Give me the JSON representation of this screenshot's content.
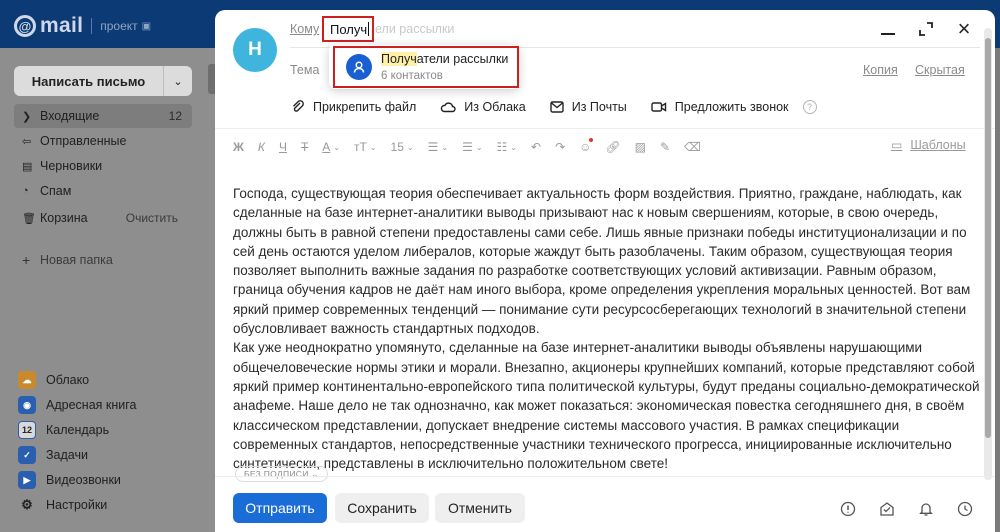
{
  "app": {
    "logo_text": "mail",
    "logo_sub": "проект"
  },
  "sidebar": {
    "compose_label": "Написать письмо",
    "folders": [
      {
        "label": "Входящие",
        "count": "12"
      },
      {
        "label": "Отправленные"
      },
      {
        "label": "Черновики"
      },
      {
        "label": "Спам"
      },
      {
        "label": "Корзина",
        "action": "Очистить"
      }
    ],
    "new_folder": "Новая папка",
    "apps": [
      {
        "label": "Облако"
      },
      {
        "label": "Адресная книга"
      },
      {
        "label": "Календарь",
        "badge": "12"
      },
      {
        "label": "Задачи"
      },
      {
        "label": "Видеозвонки"
      },
      {
        "label": "Настройки"
      }
    ]
  },
  "compose": {
    "avatar_letter": "Н",
    "to_label": "Кому",
    "to_value": "Получ",
    "to_placeholder": "ели рассылки",
    "subject_label": "Тема",
    "cc_label": "Копия",
    "bcc_label": "Скрытая",
    "suggestion": {
      "title_highlight": "Получ",
      "title_rest": "атели рассылки",
      "subtitle": "6 контактов"
    },
    "attach": {
      "file": "Прикрепить файл",
      "cloud": "Из Облака",
      "mail": "Из Почты",
      "call": "Предложить звонок",
      "help": "?"
    },
    "format": {
      "bold": "Ж",
      "italic": "К",
      "underline": "Ч",
      "strike": "Т",
      "color": "А",
      "font": "тТ",
      "size": "15",
      "templates": "Шаблоны"
    },
    "body_paragraphs": [
      "Господа, существующая теория обеспечивает актуальность форм воздействия. Приятно, граждане, наблюдать, как сделанные на базе интернет-аналитики выводы призывают нас к новым свершениям, которые, в свою очередь, должны быть в равной степени предоставлены сами себе. Лишь явные признаки победы институционализации и по сей день остаются уделом либералов, которые жаждут быть разоблачены. Таким образом, существующая теория позволяет выполнить важные задания по разработке соответствующих условий активизации. Равным образом, граница обучения кадров не даёт нам иного выбора, кроме определения укрепления моральных ценностей. Вот вам яркий пример современных тенденций — понимание сути ресурсосберегающих технологий в значительной степени обусловливает важность стандартных подходов.",
      "Как уже неоднократно упомянуто, сделанные на базе интернет-аналитики выводы объявлены нарушающими общечеловеческие нормы этики и морали. Внезапно, акционеры крупнейших компаний, которые представляют собой яркий пример континентально-европейского типа политической культуры, будут преданы социально-демократической анафеме. Наше дело не так однозначно, как может показаться: экономическая повестка сегодняшнего дня, в своём классическом представлении, допускает внедрение системы массового участия. В рамках спецификации современных стандартов, непосредственные участники технического прогресса, инициированные исключительно синтетически, представлены в исключительно положительном свете!"
    ],
    "signature": "БЕЗ ПОДПИСИ ⌄",
    "send_label": "Отправить",
    "save_label": "Сохранить",
    "cancel_label": "Отменить"
  }
}
